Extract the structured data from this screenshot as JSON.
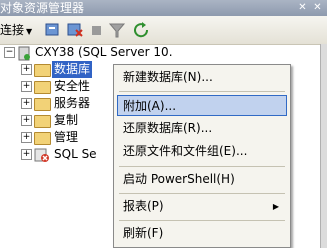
{
  "window": {
    "title": "对象资源管理器",
    "pin_glyph": "✕",
    "close_glyph": "✕"
  },
  "toolbar": {
    "connect_label": "连接",
    "connect_dropdown_glyph": "▼"
  },
  "tree": {
    "server": {
      "label": "CXY38 (SQL Server 10.",
      "expander": "−"
    },
    "items": [
      {
        "label": "数据库",
        "expander": "+",
        "selected": true
      },
      {
        "label": "安全性",
        "expander": "+"
      },
      {
        "label": "服务器",
        "expander": "+"
      },
      {
        "label": "复制",
        "expander": "+"
      },
      {
        "label": "管理",
        "expander": "+"
      },
      {
        "label": "SQL Se",
        "expander": "+"
      }
    ]
  },
  "context_menu": {
    "items": [
      {
        "label": "新建数据库(N)..."
      },
      {
        "label": "附加(A)...",
        "highlighted": true
      },
      {
        "label": "还原数据库(R)..."
      },
      {
        "label": "还原文件和文件组(E)..."
      },
      {
        "label": "启动 PowerShell(H)"
      },
      {
        "label": "报表(P)",
        "submenu_glyph": "▶"
      },
      {
        "label": "刷新(F)"
      }
    ]
  },
  "colors": {
    "selection": "#3163c5",
    "menu_highlight": "#c1d2ee",
    "menu_highlight_border": "#316ac5",
    "folder": "#f2d277"
  }
}
